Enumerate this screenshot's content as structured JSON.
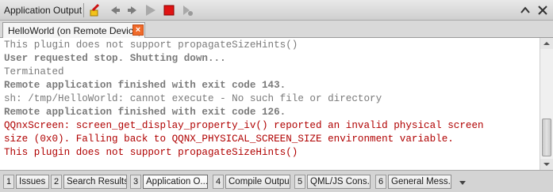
{
  "titlebar": {
    "title": "Application Output"
  },
  "tab": {
    "label": "HelloWorld (on Remote Device)",
    "close_icon": "close-icon"
  },
  "output": {
    "lines": [
      {
        "text": "This plugin does not support propagateSizeHints()",
        "style": "normal"
      },
      {
        "text": "User requested stop. Shutting down...",
        "style": "bold"
      },
      {
        "text": "Terminated",
        "style": "normal"
      },
      {
        "text": "Remote application finished with exit code 143.",
        "style": "bold"
      },
      {
        "text": "sh: /tmp/HelloWorld: cannot execute - No such file or directory",
        "style": "normal"
      },
      {
        "text": "Remote application finished with exit code 126.",
        "style": "bold"
      },
      {
        "text": "QQnxScreen: screen_get_display_property_iv() reported an invalid physical screen",
        "style": "error"
      },
      {
        "text": "size (0x0). Falling back to QQNX_PHYSICAL_SCREEN_SIZE environment variable.",
        "style": "error"
      },
      {
        "text": "This plugin does not support propagateSizeHints()",
        "style": "error"
      }
    ]
  },
  "bottom_tabs": [
    {
      "num": "1",
      "label": "Issues"
    },
    {
      "num": "2",
      "label": "Search Results"
    },
    {
      "num": "3",
      "label": "Application O..."
    },
    {
      "num": "4",
      "label": "Compile Output"
    },
    {
      "num": "5",
      "label": "QML/JS Cons..."
    },
    {
      "num": "6",
      "label": "General Mess..."
    }
  ],
  "colors": {
    "error_text": "#b00000",
    "normal_text": "#7a7a7a",
    "close_tab": "#f06a2a"
  }
}
